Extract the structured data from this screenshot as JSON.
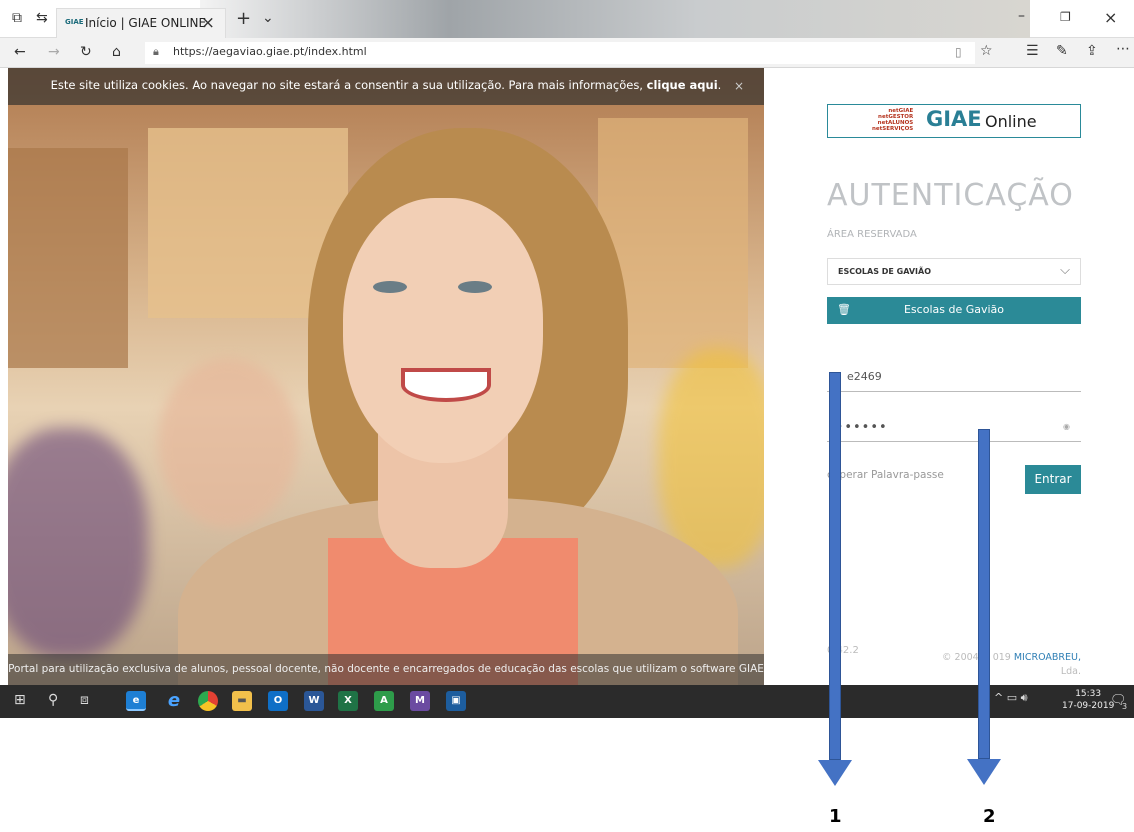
{
  "browser": {
    "tab_favicon": "GIAE",
    "tab_title": "Início | GIAE ONLINE",
    "url": "https://aegaviao.giae.pt/index.html",
    "icons": [
      "tab-set-icon",
      "tab-back-icon",
      "close-tab-icon",
      "new-tab-icon",
      "tab-list-icon",
      "minimize-icon",
      "restore-icon",
      "close-window-icon",
      "back-icon",
      "forward-icon",
      "refresh-icon",
      "home-icon",
      "lock-icon",
      "reading-view-icon",
      "favorite-star-icon",
      "favorites-icon",
      "pen-icon",
      "share-icon",
      "more-icon"
    ]
  },
  "cookie": {
    "text": "Este site utiliza cookies. Ao navegar no site estará a consentir a sua utilização. Para mais informações, ",
    "link": "clique aqui",
    "end": "."
  },
  "footer_strip": "Portal para utilização exclusiva de alunos, pessoal docente, não docente e encarregados de educação das escolas que utilizam o software GIAE",
  "login": {
    "logo_lines": [
      "netGIAE",
      "netGESTOR",
      "netALUNOS",
      "netSERVIÇOS"
    ],
    "logo_main": "GIAE",
    "logo_sub": "Online",
    "title": "AUTENTICAÇÃO",
    "area": "ÁREA RESERVADA",
    "school_selected": "ESCOLAS DE GAVIÃO",
    "school_button": "Escolas de Gavião",
    "username_value": "e2469",
    "password_value": "•••••••",
    "recover": "cuperar Palavra-passe",
    "enter": "Entrar",
    "version": "0.42.2",
    "copyright_prefix": "© 2004",
    "copyright_mid": "019 ",
    "copyright_link": "MICROABREU,",
    "copyright_end": "Lda."
  },
  "taskbar": {
    "time": "15:33",
    "date": "17-09-2019",
    "notification_count": "3"
  },
  "annotations": {
    "arrow1_label": "1",
    "arrow2_label": "2"
  },
  "colors": {
    "accent": "#2b8a97",
    "arrow": "#4472c4"
  }
}
